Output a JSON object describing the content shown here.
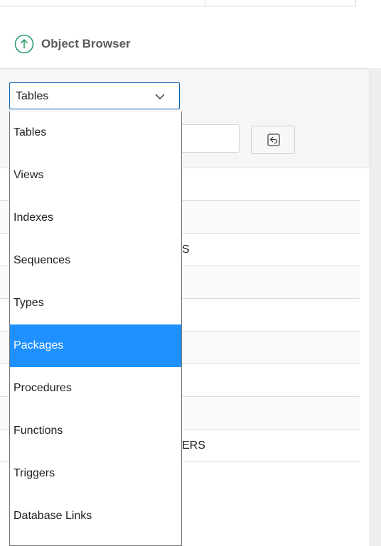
{
  "header": {
    "title": "Object Browser"
  },
  "object_type_select": {
    "value": "Tables",
    "options": [
      {
        "label": "Tables",
        "highlighted": false
      },
      {
        "label": "Views",
        "highlighted": false
      },
      {
        "label": "Indexes",
        "highlighted": false
      },
      {
        "label": "Sequences",
        "highlighted": false
      },
      {
        "label": "Types",
        "highlighted": false
      },
      {
        "label": "Packages",
        "highlighted": true
      },
      {
        "label": "Procedures",
        "highlighted": false
      },
      {
        "label": "Functions",
        "highlighted": false
      },
      {
        "label": "Triggers",
        "highlighted": false
      },
      {
        "label": "Database Links",
        "highlighted": false
      }
    ]
  },
  "object_list": {
    "rows": [
      {
        "fragment": ""
      },
      {
        "fragment": ""
      },
      {
        "fragment": "S"
      },
      {
        "fragment": ""
      },
      {
        "fragment": ""
      },
      {
        "fragment": ""
      },
      {
        "fragment": ""
      },
      {
        "fragment": ""
      },
      {
        "fragment": "ERS"
      }
    ]
  },
  "colors": {
    "accent": "#1e90ff",
    "select_border": "#0c63b0",
    "up_icon": "#2e9e6b",
    "title": "#5a5a5a"
  },
  "icons": {
    "up": "up-arrow-circle-icon",
    "chevron": "chevron-down-icon",
    "reset": "reset-icon"
  }
}
